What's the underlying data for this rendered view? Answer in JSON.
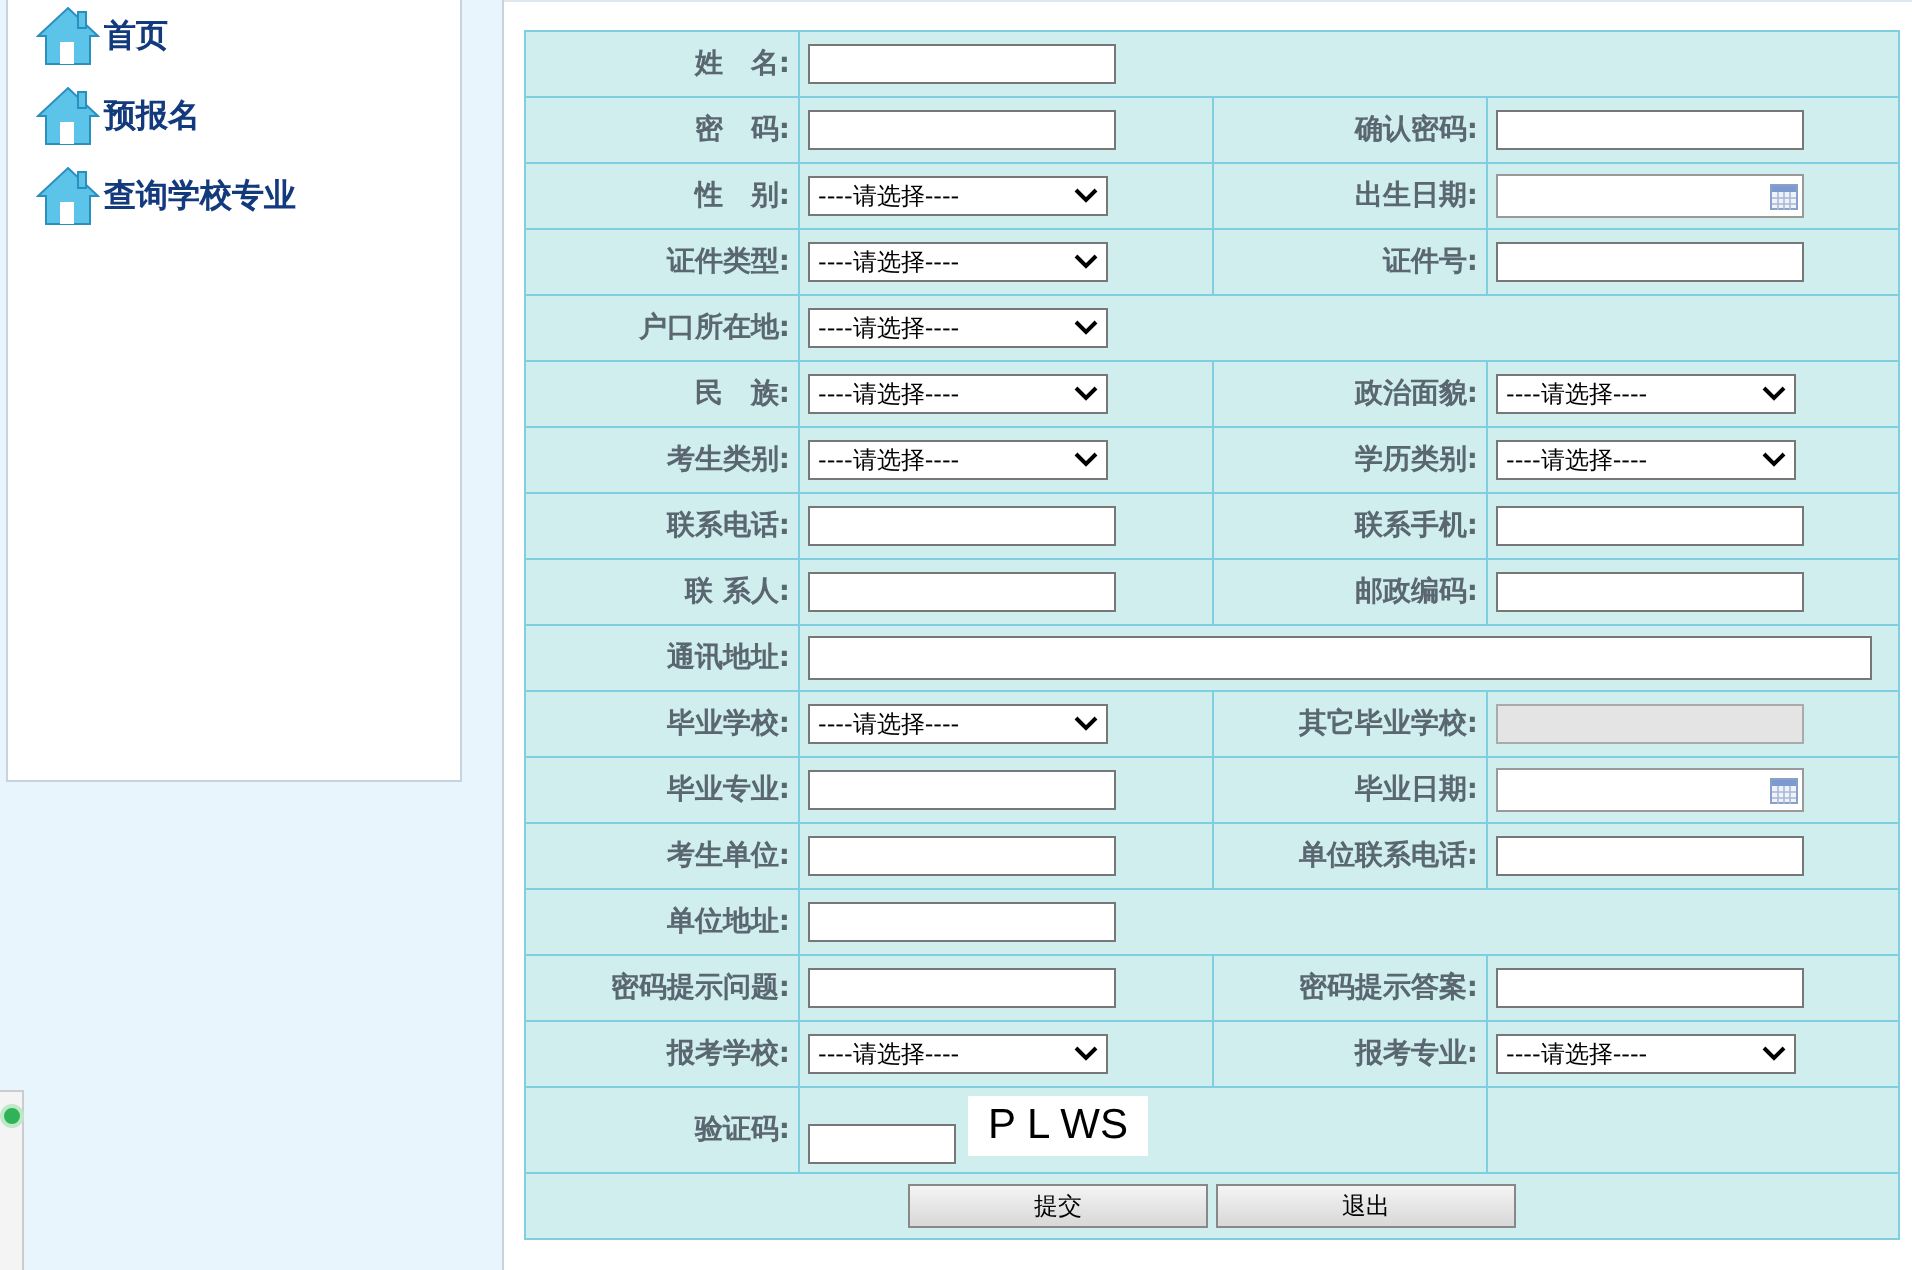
{
  "sidebar": {
    "items": [
      {
        "label": "首页"
      },
      {
        "label": "预报名"
      },
      {
        "label": "查询学校专业"
      }
    ]
  },
  "form": {
    "rows": [
      {
        "label": "姓　名:",
        "field": {
          "kind": "text"
        }
      },
      {
        "label": "密　码:",
        "field": {
          "kind": "text"
        },
        "label2": "确认密码:",
        "field2": {
          "kind": "text"
        }
      },
      {
        "label": "性　别:",
        "field": {
          "kind": "select",
          "value": "----请选择----"
        },
        "label2": "出生日期:",
        "field2": {
          "kind": "date"
        }
      },
      {
        "label": "证件类型:",
        "field": {
          "kind": "select",
          "value": "----请选择----"
        },
        "label2": "证件号:",
        "field2": {
          "kind": "text"
        }
      },
      {
        "label": "户口所在地:",
        "field": {
          "kind": "select",
          "value": "----请选择----"
        }
      },
      {
        "label": "民　族:",
        "field": {
          "kind": "select",
          "value": "----请选择----"
        },
        "label2": "政治面貌:",
        "field2": {
          "kind": "select",
          "value": "----请选择----"
        }
      },
      {
        "label": "考生类别:",
        "field": {
          "kind": "select",
          "value": "----请选择----"
        },
        "label2": "学历类别:",
        "field2": {
          "kind": "select",
          "value": "----请选择----"
        }
      },
      {
        "label": "联系电话:",
        "field": {
          "kind": "text"
        },
        "label2": "联系手机:",
        "field2": {
          "kind": "text"
        }
      },
      {
        "label": "联 系人:",
        "field": {
          "kind": "text"
        },
        "label2": "邮政编码:",
        "field2": {
          "kind": "text"
        }
      },
      {
        "label": "通讯地址:",
        "field": {
          "kind": "wide"
        }
      },
      {
        "label": "毕业学校:",
        "field": {
          "kind": "select",
          "value": "----请选择----"
        },
        "label2": "其它毕业学校:",
        "field2": {
          "kind": "disabled"
        }
      },
      {
        "label": "毕业专业:",
        "field": {
          "kind": "text"
        },
        "label2": "毕业日期:",
        "field2": {
          "kind": "date"
        }
      },
      {
        "label": "考生单位:",
        "field": {
          "kind": "text"
        },
        "label2": "单位联系电话:",
        "field2": {
          "kind": "text"
        }
      },
      {
        "label": "单位地址:",
        "field": {
          "kind": "text"
        }
      },
      {
        "label": "密码提示问题:",
        "field": {
          "kind": "text"
        },
        "label2": "密码提示答案:",
        "field2": {
          "kind": "text"
        }
      },
      {
        "label": "报考学校:",
        "field": {
          "kind": "select",
          "value": "----请选择----"
        },
        "label2": "报考专业:",
        "field2": {
          "kind": "select",
          "value": "----请选择----"
        }
      },
      {
        "label": "验证码:",
        "field": {
          "kind": "captcha",
          "code": "P L WS"
        }
      }
    ],
    "buttons": [
      "提交",
      "退出"
    ]
  }
}
